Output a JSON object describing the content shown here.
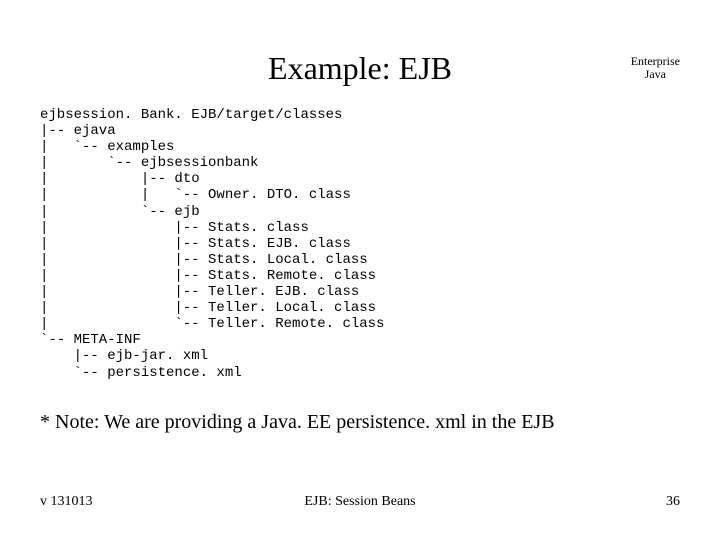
{
  "title": "Example: EJB",
  "corner_line1": "Enterprise",
  "corner_line2": "Java",
  "tree": "ejbsession. Bank. EJB/target/classes\n|-- ejava\n|   `-- examples\n|       `-- ejbsessionbank\n|           |-- dto\n|           |   `-- Owner. DTO. class\n|           `-- ejb\n|               |-- Stats. class\n|               |-- Stats. EJB. class\n|               |-- Stats. Local. class\n|               |-- Stats. Remote. class\n|               |-- Teller. EJB. class\n|               |-- Teller. Local. class\n|               `-- Teller. Remote. class\n`-- META-INF\n    |-- ejb-jar. xml\n    `-- persistence. xml",
  "note": "* Note: We are providing a Java. EE persistence. xml in the EJB",
  "footer_left": "v 131013",
  "footer_center": "EJB: Session Beans",
  "footer_right": "36"
}
